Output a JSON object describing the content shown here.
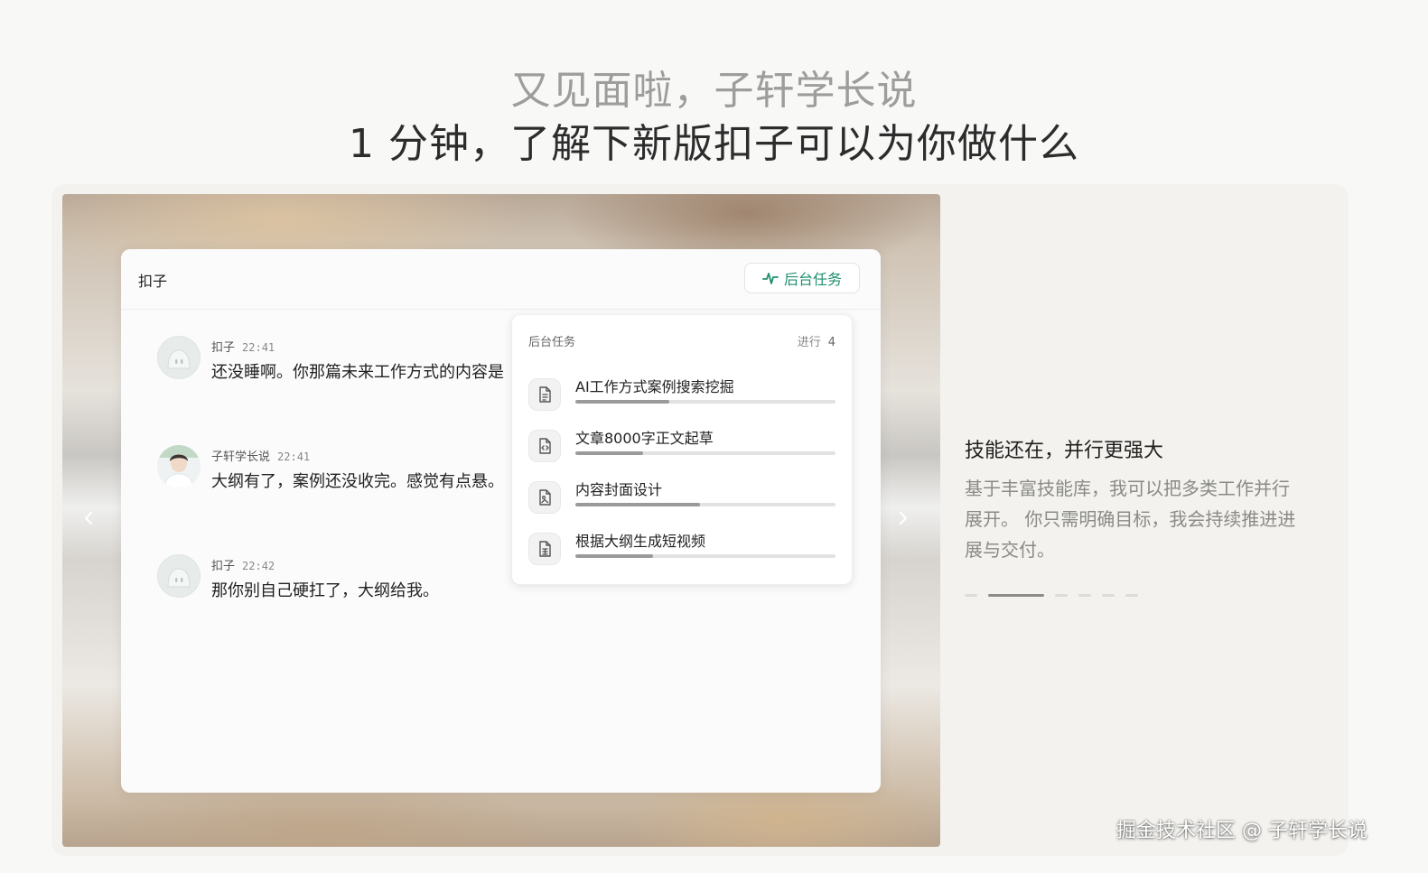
{
  "hero": {
    "greeting": "又见面啦，子轩学长说",
    "headline": "1 分钟，了解下新版扣子可以为你做什么"
  },
  "carousel": {
    "prev_icon": "chevron-left-icon",
    "next_icon": "chevron-right-icon",
    "dots": 6,
    "active_dot": 2
  },
  "app": {
    "title": "扣子",
    "bg_task_button": "后台任务",
    "accent_color": "#1e8f6e"
  },
  "messages": [
    {
      "sender": "扣子",
      "time": "22:41",
      "text": "还没睡啊。你那篇未来工作方式的内容是",
      "avatar": "bot-avatar"
    },
    {
      "sender": "子轩学长说",
      "time": "22:41",
      "text": "大纲有了，案例还没收完。感觉有点悬。",
      "avatar": "user-avatar"
    },
    {
      "sender": "扣子",
      "time": "22:42",
      "text": "那你别自己硬扛了，大纲给我。",
      "avatar": "bot-avatar"
    }
  ],
  "task_panel": {
    "title": "后台任务",
    "status_label": "进行",
    "count": "4",
    "tasks": [
      {
        "name": "AI工作方式案例搜索挖掘",
        "progress": 0.36,
        "icon": "document-icon"
      },
      {
        "name": "文章8000字正文起草",
        "progress": 0.26,
        "icon": "code-file-icon"
      },
      {
        "name": "内容封面设计",
        "progress": 0.48,
        "icon": "image-file-icon"
      },
      {
        "name": "根据大纲生成短视频",
        "progress": 0.3,
        "icon": "video-file-icon"
      }
    ]
  },
  "feature": {
    "title": "技能还在，并行更强大",
    "desc_line1": "基于丰富技能库，我可以把多类工作并行",
    "desc_line2": "展开。 你只需明确目标，我会持续推进进",
    "desc_line3": "展与交付。"
  },
  "watermark": "掘金技术社区 @ 子轩学长说"
}
